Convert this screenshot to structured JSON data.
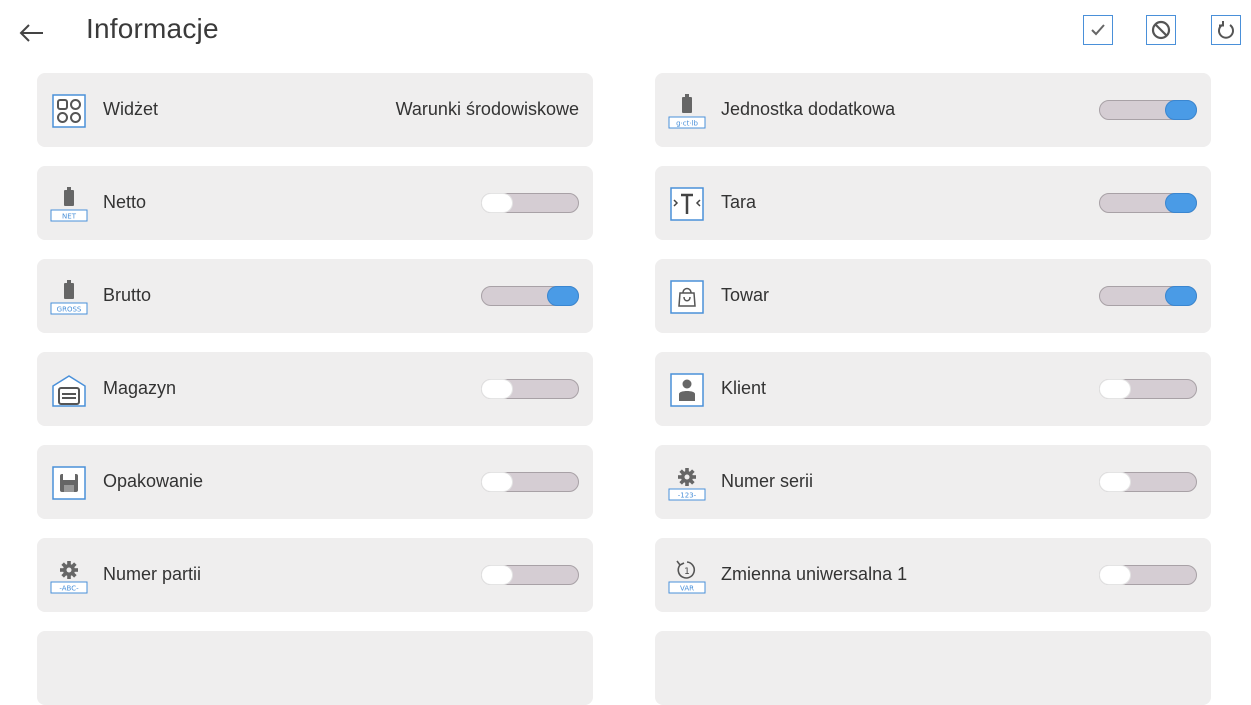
{
  "header": {
    "title": "Informacje",
    "back_icon": "back-arrow-icon",
    "actions": [
      {
        "name": "confirm",
        "icon": "check-icon"
      },
      {
        "name": "cancel",
        "icon": "cancel-icon"
      },
      {
        "name": "reset",
        "icon": "reset-icon"
      }
    ]
  },
  "colors": {
    "accent": "#4a9be6",
    "tile_bg": "#efeeee",
    "toggle_track": "#d5cdd3"
  },
  "left_column": [
    {
      "label": "Widżet",
      "value": "Warunki środowiskowe",
      "icon": "widget-icon",
      "icon_caption": ""
    },
    {
      "label": "Netto",
      "toggle": "off",
      "icon": "net-weight-icon",
      "icon_caption": "NET"
    },
    {
      "label": "Brutto",
      "toggle": "on",
      "icon": "gross-weight-icon",
      "icon_caption": "GROSS"
    },
    {
      "label": "Magazyn",
      "toggle": "off",
      "icon": "warehouse-icon",
      "icon_caption": ""
    },
    {
      "label": "Opakowanie",
      "toggle": "off",
      "icon": "packaging-icon",
      "icon_caption": ""
    },
    {
      "label": "Numer partii",
      "toggle": "off",
      "icon": "batch-number-icon",
      "icon_caption": "-ABC-"
    }
  ],
  "right_column": [
    {
      "label": "Jednostka dodatkowa",
      "toggle": "on",
      "icon": "extra-unit-icon",
      "icon_caption": "g·ct·lb"
    },
    {
      "label": "Tara",
      "toggle": "on",
      "icon": "tare-icon",
      "icon_caption": ""
    },
    {
      "label": "Towar",
      "toggle": "on",
      "icon": "product-icon",
      "icon_caption": ""
    },
    {
      "label": "Klient",
      "toggle": "off",
      "icon": "client-icon",
      "icon_caption": ""
    },
    {
      "label": "Numer serii",
      "toggle": "off",
      "icon": "series-number-icon",
      "icon_caption": "-123-"
    },
    {
      "label": "Zmienna uniwersalna 1",
      "toggle": "off",
      "icon": "universal-variable-icon",
      "icon_caption": "VAR"
    }
  ]
}
